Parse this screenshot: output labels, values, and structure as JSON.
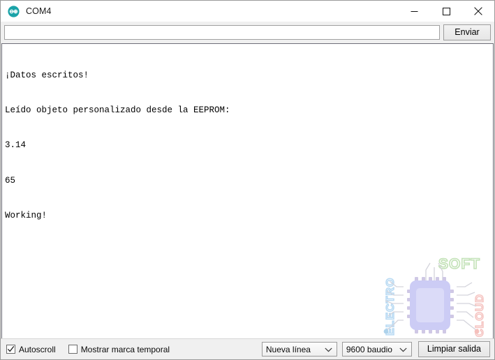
{
  "window": {
    "title": "COM4",
    "app_icon": "arduino-logo-icon",
    "minimize_label": "Minimizar",
    "maximize_label": "Maximizar",
    "close_label": "Cerrar"
  },
  "send_row": {
    "input_value": "",
    "input_placeholder": "",
    "send_label": "Enviar"
  },
  "console": {
    "lines": [
      "¡Datos escritos!",
      "Leído objeto personalizado desde la EEPROM:",
      "3.14",
      "65",
      "Working!"
    ]
  },
  "watermark": {
    "text_top": "SOFT",
    "text_left": "ELECTRO",
    "text_right": "CLOUD",
    "color_top": "#b6dba6",
    "color_left": "#9dcdf0",
    "color_right": "#f4aaa5",
    "chip_color": "#aeaef0",
    "chip_inner_color": "#c3c3f4"
  },
  "status_bar": {
    "autoscroll_label": "Autoscroll",
    "autoscroll_checked": true,
    "timestamp_label": "Mostrar marca temporal",
    "timestamp_checked": false,
    "line_ending_value": "Nueva línea",
    "baud_value": "9600 baudio",
    "clear_label": "Limpiar salida"
  },
  "colors": {
    "accent": "#00979c",
    "window_bg": "#f0f0f0",
    "console_bg": "#ffffff",
    "border": "#6e6e78"
  }
}
